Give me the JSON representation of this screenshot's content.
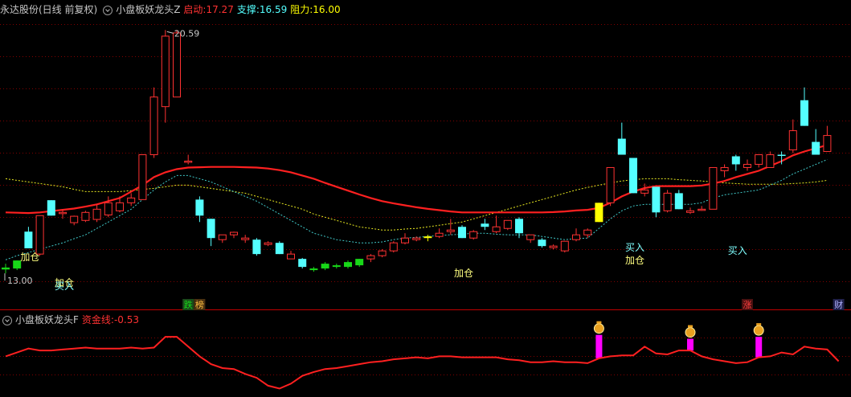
{
  "header": {
    "stock": "永达股份(日线 前复权)",
    "indicator": "小盘板妖龙头Z",
    "start_label": "启动:",
    "start_value": "17.27",
    "support_label": "支撑:",
    "support_value": "16.59",
    "resist_label": "阻力:",
    "resist_value": "16.00"
  },
  "sub_header": {
    "indicator": "小盘板妖龙头F",
    "fund_label": "资金线:",
    "fund_value": "-0.53"
  },
  "colors": {
    "up": "#ff3232",
    "down": "#54ffff",
    "green": "#18d818",
    "yellow": "#ffff00",
    "ma_red": "#ff2020",
    "ma_cyan": "#40c8c8",
    "ma_yellow": "#e8e820",
    "fund": "#ff2020",
    "bar": "#ff00ff",
    "grid": "#800000"
  },
  "chart_data": [
    {
      "type": "candlestick",
      "title": "小盘板妖龙头Z",
      "ylim": [
        12.3,
        20.9
      ],
      "max_label": "20.59",
      "min_label": "13.00",
      "candles": [
        {
          "o": 13.12,
          "h": 13.3,
          "l": 13.0,
          "c": 13.18,
          "k": "g"
        },
        {
          "o": 13.15,
          "h": 13.4,
          "l": 13.1,
          "c": 13.4,
          "k": "g"
        },
        {
          "o": 14.3,
          "h": 14.45,
          "l": 13.78,
          "c": 13.78,
          "k": "d"
        },
        {
          "o": 13.6,
          "h": 14.8,
          "l": 13.55,
          "c": 14.8,
          "k": "r"
        },
        {
          "o": 15.28,
          "h": 15.28,
          "l": 14.8,
          "c": 14.8,
          "k": "d"
        },
        {
          "o": 14.9,
          "h": 15.0,
          "l": 14.7,
          "c": 14.88,
          "k": "x"
        },
        {
          "o": 14.58,
          "h": 14.8,
          "l": 14.5,
          "c": 14.78,
          "k": "r"
        },
        {
          "o": 14.65,
          "h": 14.95,
          "l": 14.6,
          "c": 14.9,
          "k": "r"
        },
        {
          "o": 14.68,
          "h": 15.15,
          "l": 14.6,
          "c": 15.0,
          "k": "r"
        },
        {
          "o": 14.82,
          "h": 15.4,
          "l": 14.75,
          "c": 15.2,
          "k": "r"
        },
        {
          "o": 14.95,
          "h": 15.4,
          "l": 14.9,
          "c": 15.2,
          "k": "r"
        },
        {
          "o": 15.2,
          "h": 15.5,
          "l": 15.1,
          "c": 15.35,
          "k": "r"
        },
        {
          "o": 15.3,
          "h": 16.7,
          "l": 15.3,
          "c": 16.7,
          "k": "r"
        },
        {
          "o": 16.7,
          "h": 18.8,
          "l": 16.6,
          "c": 18.5,
          "k": "r"
        },
        {
          "o": 18.2,
          "h": 20.59,
          "l": 17.7,
          "c": 20.4,
          "k": "r"
        },
        {
          "o": 20.5,
          "h": 20.59,
          "l": 18.5,
          "c": 18.5,
          "k": "x"
        },
        {
          "o": 16.5,
          "h": 16.7,
          "l": 16.4,
          "c": 16.5,
          "k": "x"
        },
        {
          "o": 15.3,
          "h": 15.4,
          "l": 14.6,
          "c": 14.8,
          "k": "d"
        },
        {
          "o": 14.7,
          "h": 14.7,
          "l": 13.85,
          "c": 14.1,
          "k": "d"
        },
        {
          "o": 14.05,
          "h": 14.2,
          "l": 13.95,
          "c": 14.2,
          "k": "r"
        },
        {
          "o": 14.2,
          "h": 14.3,
          "l": 14.1,
          "c": 14.28,
          "k": "r"
        },
        {
          "o": 14.1,
          "h": 14.2,
          "l": 13.95,
          "c": 14.05,
          "k": "x"
        },
        {
          "o": 14.05,
          "h": 14.1,
          "l": 13.55,
          "c": 13.6,
          "k": "d"
        },
        {
          "o": 13.95,
          "h": 14.0,
          "l": 13.85,
          "c": 13.9,
          "k": "x"
        },
        {
          "o": 13.95,
          "h": 14.0,
          "l": 13.6,
          "c": 13.6,
          "k": "d"
        },
        {
          "o": 13.6,
          "h": 13.7,
          "l": 13.45,
          "c": 13.45,
          "k": "x"
        },
        {
          "o": 13.45,
          "h": 13.48,
          "l": 13.15,
          "c": 13.2,
          "k": "d"
        },
        {
          "o": 13.15,
          "h": 13.2,
          "l": 13.05,
          "c": 13.1,
          "k": "g"
        },
        {
          "o": 13.15,
          "h": 13.35,
          "l": 13.1,
          "c": 13.3,
          "k": "g"
        },
        {
          "o": 13.2,
          "h": 13.3,
          "l": 13.15,
          "c": 13.25,
          "k": "g"
        },
        {
          "o": 13.2,
          "h": 13.4,
          "l": 13.15,
          "c": 13.35,
          "k": "g"
        },
        {
          "o": 13.25,
          "h": 13.45,
          "l": 13.2,
          "c": 13.45,
          "k": "g"
        },
        {
          "o": 13.45,
          "h": 13.6,
          "l": 13.35,
          "c": 13.55,
          "k": "r"
        },
        {
          "o": 13.55,
          "h": 13.75,
          "l": 13.5,
          "c": 13.7,
          "k": "r"
        },
        {
          "o": 13.7,
          "h": 14.0,
          "l": 13.65,
          "c": 13.95,
          "k": "r"
        },
        {
          "o": 13.95,
          "h": 14.25,
          "l": 13.9,
          "c": 14.1,
          "k": "r"
        },
        {
          "o": 14.1,
          "h": 14.15,
          "l": 14.0,
          "c": 14.05,
          "k": "x"
        },
        {
          "o": 14.1,
          "h": 14.2,
          "l": 14.0,
          "c": 14.15,
          "k": "y"
        },
        {
          "o": 14.15,
          "h": 14.4,
          "l": 14.1,
          "c": 14.25,
          "k": "r"
        },
        {
          "o": 14.3,
          "h": 14.7,
          "l": 14.2,
          "c": 14.35,
          "k": "r"
        },
        {
          "o": 14.45,
          "h": 14.5,
          "l": 14.1,
          "c": 14.1,
          "k": "d"
        },
        {
          "o": 14.1,
          "h": 14.35,
          "l": 14.05,
          "c": 14.3,
          "k": "r"
        },
        {
          "o": 14.45,
          "h": 14.7,
          "l": 14.35,
          "c": 14.55,
          "k": "d"
        },
        {
          "o": 14.3,
          "h": 14.8,
          "l": 14.25,
          "c": 14.45,
          "k": "r"
        },
        {
          "o": 14.4,
          "h": 14.65,
          "l": 14.35,
          "c": 14.65,
          "k": "r"
        },
        {
          "o": 14.7,
          "h": 14.75,
          "l": 14.1,
          "c": 14.25,
          "k": "d"
        },
        {
          "o": 14.2,
          "h": 14.2,
          "l": 13.95,
          "c": 14.05,
          "k": "x"
        },
        {
          "o": 14.05,
          "h": 14.1,
          "l": 13.8,
          "c": 13.85,
          "k": "d"
        },
        {
          "o": 13.85,
          "h": 13.9,
          "l": 13.75,
          "c": 13.8,
          "k": "x"
        },
        {
          "o": 13.7,
          "h": 14.0,
          "l": 13.65,
          "c": 14.0,
          "k": "r"
        },
        {
          "o": 14.05,
          "h": 14.4,
          "l": 14.0,
          "c": 14.2,
          "k": "r"
        },
        {
          "o": 14.2,
          "h": 14.4,
          "l": 14.1,
          "c": 14.35,
          "k": "r"
        },
        {
          "o": 14.6,
          "h": 15.2,
          "l": 14.6,
          "c": 15.2,
          "k": "y"
        },
        {
          "o": 15.2,
          "h": 16.3,
          "l": 15.1,
          "c": 16.3,
          "k": "r"
        },
        {
          "o": 17.2,
          "h": 17.7,
          "l": 16.7,
          "c": 16.7,
          "k": "d"
        },
        {
          "o": 16.6,
          "h": 16.6,
          "l": 15.5,
          "c": 15.5,
          "k": "d"
        },
        {
          "o": 15.5,
          "h": 15.8,
          "l": 15.4,
          "c": 15.6,
          "k": "r"
        },
        {
          "o": 15.7,
          "h": 15.7,
          "l": 14.75,
          "c": 14.9,
          "k": "d"
        },
        {
          "o": 14.95,
          "h": 15.6,
          "l": 14.9,
          "c": 15.5,
          "k": "r"
        },
        {
          "o": 15.5,
          "h": 15.6,
          "l": 15.0,
          "c": 15.0,
          "k": "d"
        },
        {
          "o": 14.9,
          "h": 15.05,
          "l": 14.85,
          "c": 14.95,
          "k": "r"
        },
        {
          "o": 15.0,
          "h": 15.1,
          "l": 14.95,
          "c": 15.0,
          "k": "x"
        },
        {
          "o": 15.0,
          "h": 16.3,
          "l": 15.0,
          "c": 16.3,
          "k": "r"
        },
        {
          "o": 16.2,
          "h": 16.4,
          "l": 16.0,
          "c": 16.3,
          "k": "x"
        },
        {
          "o": 16.4,
          "h": 16.7,
          "l": 16.2,
          "c": 16.65,
          "k": "d"
        },
        {
          "o": 16.3,
          "h": 16.55,
          "l": 16.2,
          "c": 16.4,
          "k": "r"
        },
        {
          "o": 16.4,
          "h": 16.7,
          "l": 16.3,
          "c": 16.7,
          "k": "r"
        },
        {
          "o": 16.3,
          "h": 16.8,
          "l": 16.3,
          "c": 16.7,
          "k": "r"
        },
        {
          "o": 16.7,
          "h": 16.8,
          "l": 16.4,
          "c": 16.7,
          "k": "d"
        },
        {
          "o": 16.85,
          "h": 17.8,
          "l": 16.75,
          "c": 17.45,
          "k": "r"
        },
        {
          "o": 18.4,
          "h": 18.8,
          "l": 17.6,
          "c": 17.6,
          "k": "d"
        },
        {
          "o": 17.1,
          "h": 17.5,
          "l": 16.7,
          "c": 16.7,
          "k": "d"
        },
        {
          "o": 16.8,
          "h": 17.6,
          "l": 16.8,
          "c": 17.3,
          "k": "r"
        }
      ],
      "ma_red": [
        14.9,
        14.89,
        14.88,
        14.9,
        14.94,
        14.98,
        15.02,
        15.08,
        15.15,
        15.25,
        15.35,
        15.55,
        15.75,
        16.0,
        16.15,
        16.25,
        16.3,
        16.31,
        16.32,
        16.32,
        16.32,
        16.31,
        16.3,
        16.27,
        16.22,
        16.15,
        16.05,
        15.95,
        15.82,
        15.7,
        15.58,
        15.46,
        15.35,
        15.25,
        15.18,
        15.12,
        15.06,
        15.01,
        14.97,
        14.93,
        14.9,
        14.9,
        14.9,
        14.9,
        14.9,
        14.9,
        14.9,
        14.9,
        14.91,
        14.93,
        14.96,
        14.98,
        15.04,
        15.2,
        15.4,
        15.55,
        15.66,
        15.72,
        15.72,
        15.72,
        15.72,
        15.74,
        15.8,
        15.88,
        16.0,
        16.1,
        16.2,
        16.35,
        16.5,
        16.68,
        16.8,
        16.9,
        17.0
      ],
      "ma_cyan": [
        13.42,
        13.55,
        13.65,
        13.75,
        13.85,
        13.95,
        14.08,
        14.2,
        14.4,
        14.6,
        14.8,
        15.0,
        15.3,
        15.6,
        15.85,
        16.05,
        16.05,
        15.95,
        15.85,
        15.7,
        15.55,
        15.4,
        15.25,
        15.05,
        14.85,
        14.65,
        14.45,
        14.25,
        14.15,
        14.05,
        14.0,
        13.95,
        13.95,
        13.98,
        14.05,
        14.1,
        14.12,
        14.15,
        14.18,
        14.2,
        14.22,
        14.25,
        14.25,
        14.22,
        14.2,
        14.2,
        14.2,
        14.15,
        14.1,
        14.05,
        14.08,
        14.1,
        14.4,
        14.7,
        14.95,
        15.1,
        15.15,
        15.15,
        15.15,
        15.15,
        15.15,
        15.2,
        15.35,
        15.45,
        15.5,
        15.55,
        15.6,
        15.75,
        15.9,
        16.1,
        16.25,
        16.4,
        16.55
      ],
      "ma_yellow": [
        15.95,
        15.9,
        15.85,
        15.8,
        15.75,
        15.7,
        15.62,
        15.55,
        15.55,
        15.55,
        15.55,
        15.58,
        15.62,
        15.65,
        15.7,
        15.75,
        15.75,
        15.7,
        15.65,
        15.6,
        15.55,
        15.5,
        15.4,
        15.3,
        15.2,
        15.1,
        15.0,
        14.85,
        14.75,
        14.65,
        14.55,
        14.45,
        14.4,
        14.35,
        14.35,
        14.38,
        14.4,
        14.45,
        14.5,
        14.55,
        14.6,
        14.7,
        14.8,
        14.9,
        15.0,
        15.1,
        15.2,
        15.3,
        15.4,
        15.5,
        15.6,
        15.68,
        15.75,
        15.82,
        15.88,
        15.92,
        15.95,
        15.95,
        15.95,
        15.92,
        15.9,
        15.88,
        15.85,
        15.82,
        15.8,
        15.78,
        15.78,
        15.78,
        15.78,
        15.8,
        15.82,
        15.85,
        15.9
      ],
      "annotations": [
        {
          "i": 0,
          "text": "13.00",
          "color": "#c8c8c8",
          "type": "min"
        },
        {
          "i": 2,
          "text": "加仓",
          "color": "#ffff80",
          "type": "label",
          "y": 13.4
        },
        {
          "i": 5,
          "text": "加仓",
          "color": "#ffff80",
          "type": "label",
          "y": 12.6
        },
        {
          "i": 5,
          "text": "买入",
          "color": "#80ffff",
          "type": "label",
          "y": 12.5
        },
        {
          "i": 40,
          "text": "加仓",
          "color": "#ffff80",
          "type": "label",
          "y": 12.9
        },
        {
          "i": 55,
          "text": "买入",
          "color": "#80ffff",
          "type": "label",
          "y": 13.7
        },
        {
          "i": 55,
          "text": "加仓",
          "color": "#ffff80",
          "type": "label",
          "y": 13.3
        },
        {
          "i": 64,
          "text": "买入",
          "color": "#80ffff",
          "type": "label",
          "y": 13.6
        }
      ],
      "badges": [
        {
          "i": 16,
          "text": "跌",
          "fg": "#18d818",
          "bg": "#1a4a1a"
        },
        {
          "i": 17,
          "text": "榜",
          "fg": "#ffc040",
          "bg": "#4a3010"
        },
        {
          "i": 65,
          "text": "涨",
          "fg": "#ff4040",
          "bg": "#4a1010"
        },
        {
          "i": 73,
          "text": "财",
          "fg": "#b0b0ff",
          "bg": "#20204a"
        }
      ]
    },
    {
      "type": "line",
      "title": "小盘板妖龙头F",
      "ylim": [
        -4,
        3
      ],
      "series": [
        {
          "name": "资金线",
          "values": [
            0.0,
            0.4,
            0.8,
            0.6,
            0.6,
            0.7,
            0.8,
            0.9,
            0.8,
            0.8,
            0.8,
            0.9,
            0.8,
            0.9,
            2.0,
            2.0,
            1.0,
            0.0,
            -0.8,
            -1.2,
            -1.3,
            -1.8,
            -2.2,
            -3.0,
            -3.3,
            -2.8,
            -2.0,
            -1.6,
            -1.3,
            -1.2,
            -1.0,
            -0.8,
            -0.6,
            -0.5,
            -0.3,
            -0.2,
            -0.1,
            -0.2,
            0.0,
            0.0,
            -0.1,
            -0.1,
            -0.1,
            -0.1,
            -0.3,
            -0.4,
            -0.6,
            -0.6,
            -0.5,
            -0.6,
            -0.6,
            -0.7,
            -0.2,
            0.0,
            0.1,
            0.1,
            1.0,
            0.3,
            0.2,
            0.6,
            0.6,
            0.0,
            -0.3,
            -0.5,
            -0.7,
            -0.6,
            -0.1,
            0.0,
            0.4,
            0.2,
            1.0,
            0.8,
            0.7,
            -0.5
          ]
        }
      ],
      "bars": [
        {
          "i": 52,
          "value": 2.2
        },
        {
          "i": 60,
          "value": 1.8
        },
        {
          "i": 66,
          "value": 2.0
        }
      ]
    }
  ]
}
